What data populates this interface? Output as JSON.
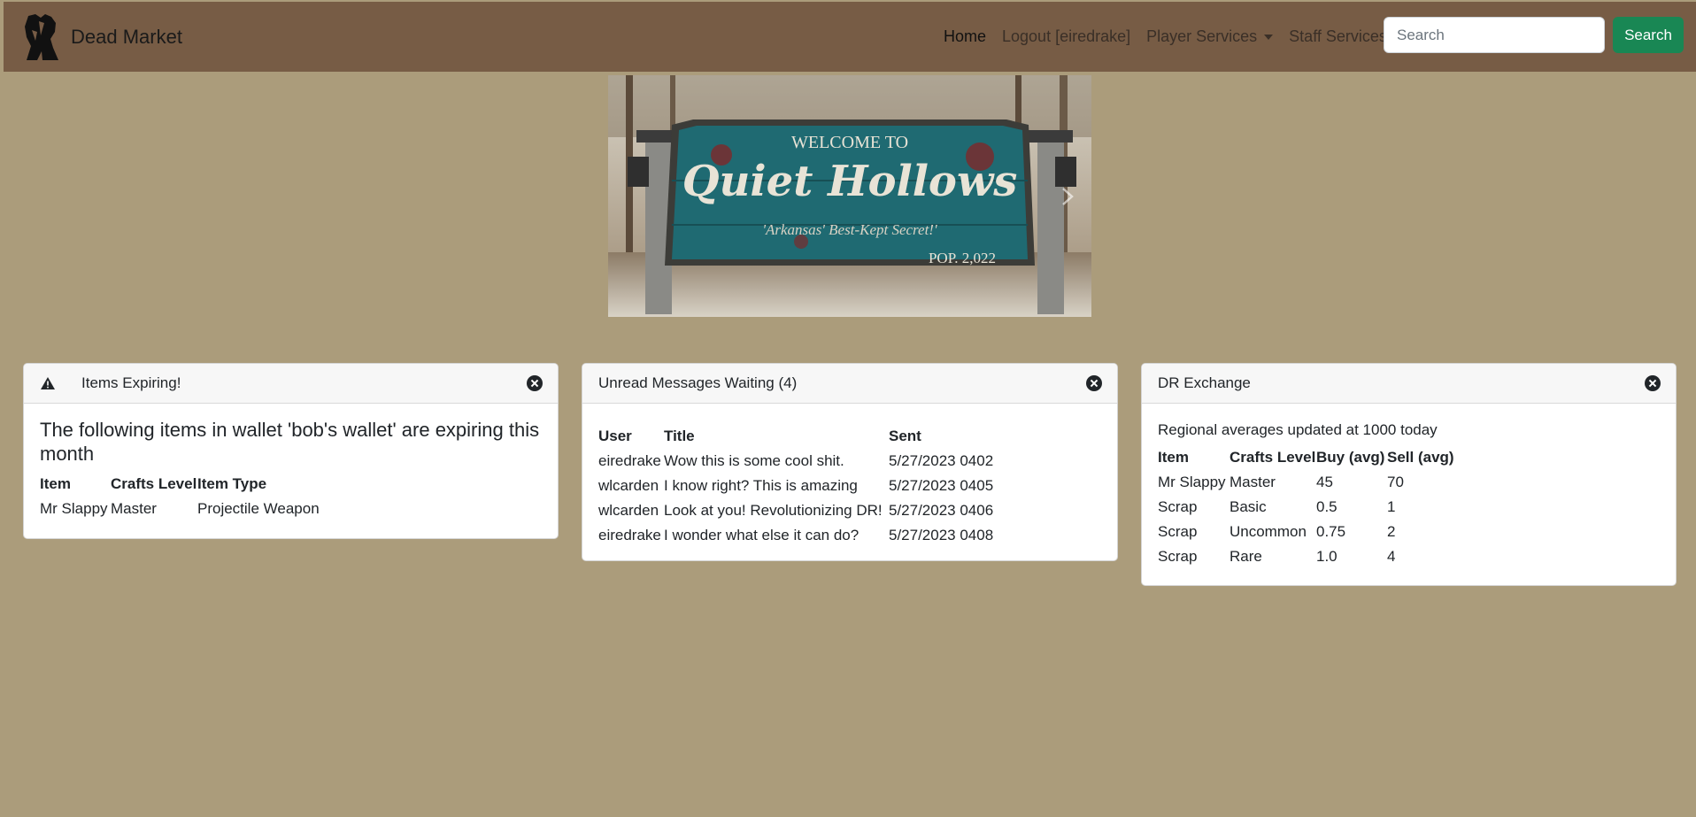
{
  "navbar": {
    "brand": "Dead Market",
    "links": {
      "home": "Home",
      "logout": "Logout [eiredrake]",
      "player_services": "Player Services",
      "staff_services": "Staff Services"
    },
    "search_placeholder": "Search",
    "search_button": "Search"
  },
  "hero": {
    "sign_welcome": "WELCOME TO",
    "sign_title": "Quiet Hollows",
    "sign_tagline": "'Arkansas' Best-Kept Secret!'",
    "sign_population": "POP. 2,022"
  },
  "expiring": {
    "title": "Items Expiring!",
    "message": "The following items in wallet 'bob's wallet' are expiring this month",
    "columns": [
      "Item",
      "Crafts Level",
      "Item Type"
    ],
    "rows": [
      [
        "Mr Slappy",
        "Master",
        "Projectile Weapon"
      ]
    ]
  },
  "messages": {
    "title": "Unread Messages Waiting (4)",
    "columns": [
      "User",
      "Title",
      "Sent"
    ],
    "rows": [
      [
        "eiredrake",
        "Wow this is some cool shit.",
        "5/27/2023 0402"
      ],
      [
        "wlcarden",
        "I know right? This is amazing",
        "5/27/2023 0405"
      ],
      [
        "wlcarden",
        "Look at you! Revolutionizing DR!",
        "5/27/2023 0406"
      ],
      [
        "eiredrake",
        "I wonder what else it can do?",
        "5/27/2023 0408"
      ]
    ]
  },
  "exchange": {
    "title": "DR Exchange",
    "subtitle": "Regional averages updated at 1000 today",
    "columns": [
      "Item",
      "Crafts Level",
      "Buy (avg)",
      "Sell (avg)"
    ],
    "rows": [
      [
        "Mr Slappy",
        "Master",
        "45",
        "70"
      ],
      [
        "Scrap",
        "Basic",
        "0.5",
        "1"
      ],
      [
        "Scrap",
        "Uncommon",
        "0.75",
        "2"
      ],
      [
        "Scrap",
        "Rare",
        "1.0",
        "4"
      ]
    ]
  },
  "colors": {
    "page_background": "#ab9c7b",
    "navbar_background": "#775c45",
    "search_button": "#198754"
  }
}
